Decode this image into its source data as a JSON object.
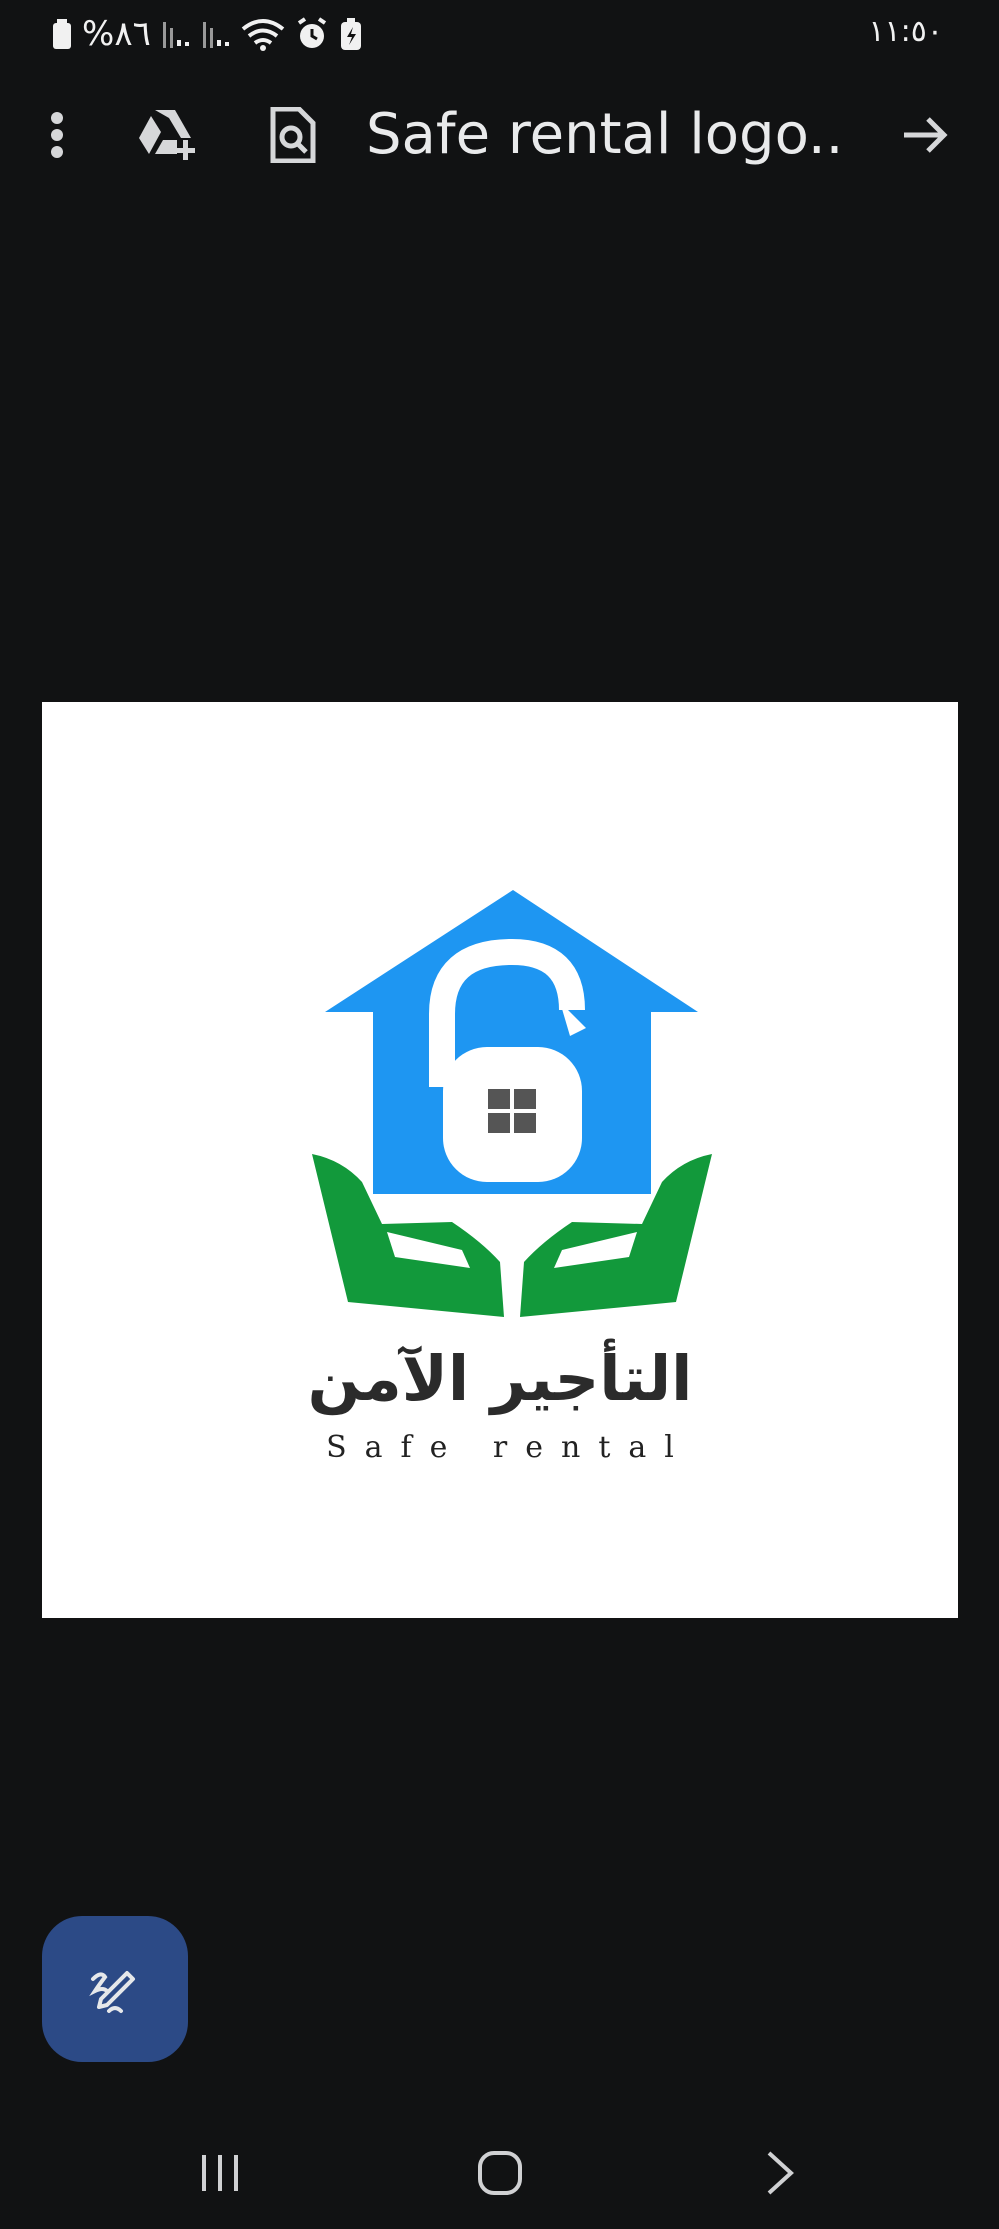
{
  "status_bar": {
    "battery_text": "%٨٦",
    "time": "١١:٥٠",
    "icons": [
      "battery-icon",
      "signal-icon",
      "signal-icon",
      "wifi-icon",
      "alarm-icon",
      "battery-saver-icon"
    ]
  },
  "app_bar": {
    "title": "Safe rental logo....",
    "icons": [
      "more-vert-icon",
      "drive-add-icon",
      "file-search-icon",
      "arrow-forward-icon"
    ]
  },
  "preview_image": {
    "arabic_text": "التأجير الآمن",
    "english_text": "Safe rental",
    "colors": {
      "house": "#1e96f2",
      "hands": "#12993b",
      "lock": "#ffffff",
      "window": "#555555"
    }
  },
  "fab": {
    "icon": "edit-pencil-icon",
    "color": "#2c4a86"
  },
  "nav_bar": {
    "icons": [
      "recents-icon",
      "home-icon",
      "back-icon"
    ]
  }
}
